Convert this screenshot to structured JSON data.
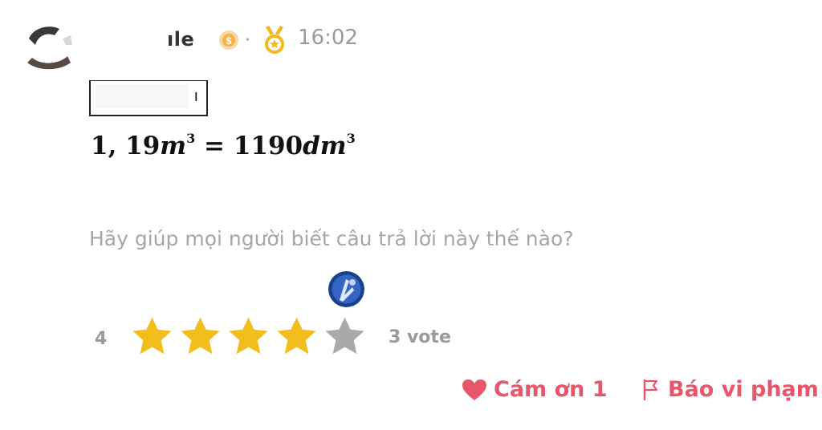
{
  "author": {
    "name_fragment": "ıle",
    "time": "16:02",
    "separator": "·"
  },
  "answer": {
    "label_fragment": "ı",
    "expression": {
      "lhs_number": "1, 19",
      "lhs_unit": "m",
      "lhs_exp": "3",
      "equals": "=",
      "rhs_number": "1190",
      "rhs_unit": "dm",
      "rhs_exp": "3"
    }
  },
  "feedback": {
    "prompt": "Hãy giúp mọi người biết câu trả lời này thế nào?",
    "rating": "4",
    "rating_value": 4,
    "max_stars": 5,
    "vote_count": "3 vote",
    "star_color_on": "#f2bd1d",
    "star_color_off": "#a9a9a9"
  },
  "actions": {
    "thanks_label": "Cám ơn 1",
    "report_label": "Báo vi phạm",
    "accent_color": "#e8566b"
  }
}
